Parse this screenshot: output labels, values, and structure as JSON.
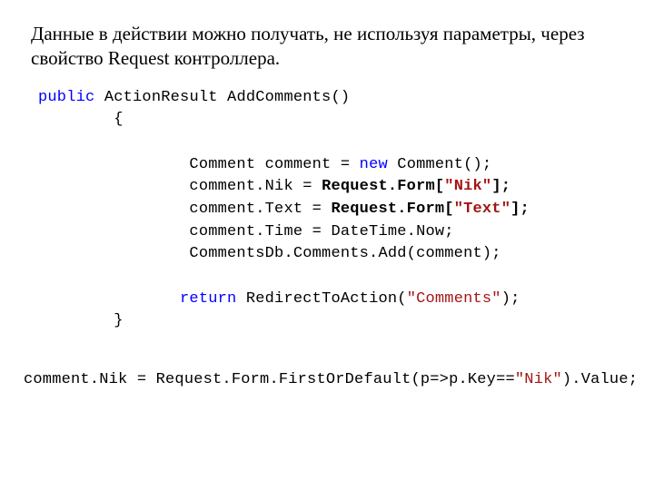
{
  "intro": "Данные в действии можно получать, не используя параметры, через свойство Request контроллера.",
  "code1": {
    "l1_kw": "public",
    "l1_rest": " ActionResult AddComments()",
    "l2": "        {",
    "l3_a": "                Comment comment = ",
    "l3_kw": "new",
    "l3_b": " Comment();",
    "l4_a": "                comment.Nik = ",
    "l4_b": "Request.Form[",
    "l4_str": "\"Nik\"",
    "l4_c": "];",
    "l5_a": "                comment.Text = ",
    "l5_b": "Request.Form[",
    "l5_str": "\"Text\"",
    "l5_c": "];",
    "l6": "                comment.Time = DateTime.Now;",
    "l7": "                CommentsDb.Comments.Add(comment);",
    "l8_pad": "               ",
    "l8_kw": "return",
    "l8_a": " RedirectToAction(",
    "l8_str": "\"Comments\"",
    "l8_b": ");",
    "l9": "        }"
  },
  "code2": {
    "a": "comment.Nik = Request.Form.FirstOrDefault(p=>p.Key==",
    "str": "\"Nik\"",
    "b": ").Value;"
  }
}
